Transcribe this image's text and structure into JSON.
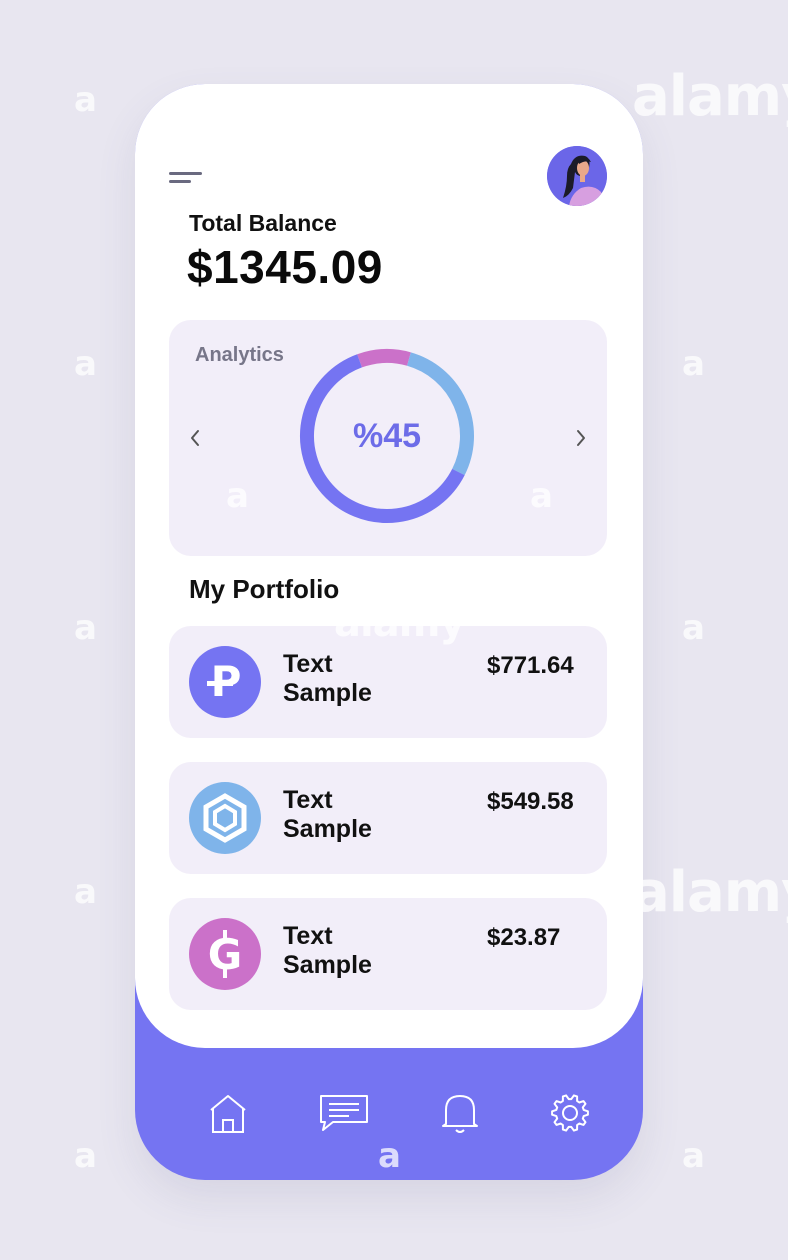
{
  "header": {
    "balance_label": "Total Balance",
    "balance_amount": "$1345.09",
    "menu_icon": "hamburger-menu-icon",
    "avatar_icon": "user-avatar"
  },
  "analytics": {
    "title": "Analytics",
    "percent_label": "%45",
    "prev_icon": "chevron-left-icon",
    "next_icon": "chevron-right-icon",
    "ring_colors": [
      "#7574f2",
      "#7fb4ea",
      "#cb71c9"
    ]
  },
  "chart_data": {
    "type": "pie",
    "title": "",
    "center_label": "%45",
    "slices": [
      {
        "value": 10,
        "color": "#cb71c9"
      },
      {
        "value": 28,
        "color": "#7fb4ea"
      },
      {
        "value": 62,
        "color": "#7574f2"
      }
    ]
  },
  "portfolio": {
    "title": "My Portfolio",
    "items": [
      {
        "name": "Text Sample",
        "value": "$771.64",
        "icon": "p-coin-icon",
        "color": "#7574f2"
      },
      {
        "name": "Text Sample",
        "value": "$549.58",
        "icon": "hexagon-coin-icon",
        "color": "#7fb4ea"
      },
      {
        "name": "Text Sample",
        "value": "$23.87",
        "icon": "g-coin-icon",
        "color": "#cb71c9"
      }
    ]
  },
  "bottom_nav": {
    "items": [
      {
        "icon": "home-icon"
      },
      {
        "icon": "chat-icon"
      },
      {
        "icon": "bell-icon"
      },
      {
        "icon": "gear-icon"
      }
    ],
    "background": "#7574f2"
  },
  "watermark": {
    "brand": "alamy",
    "glyph": "a"
  }
}
